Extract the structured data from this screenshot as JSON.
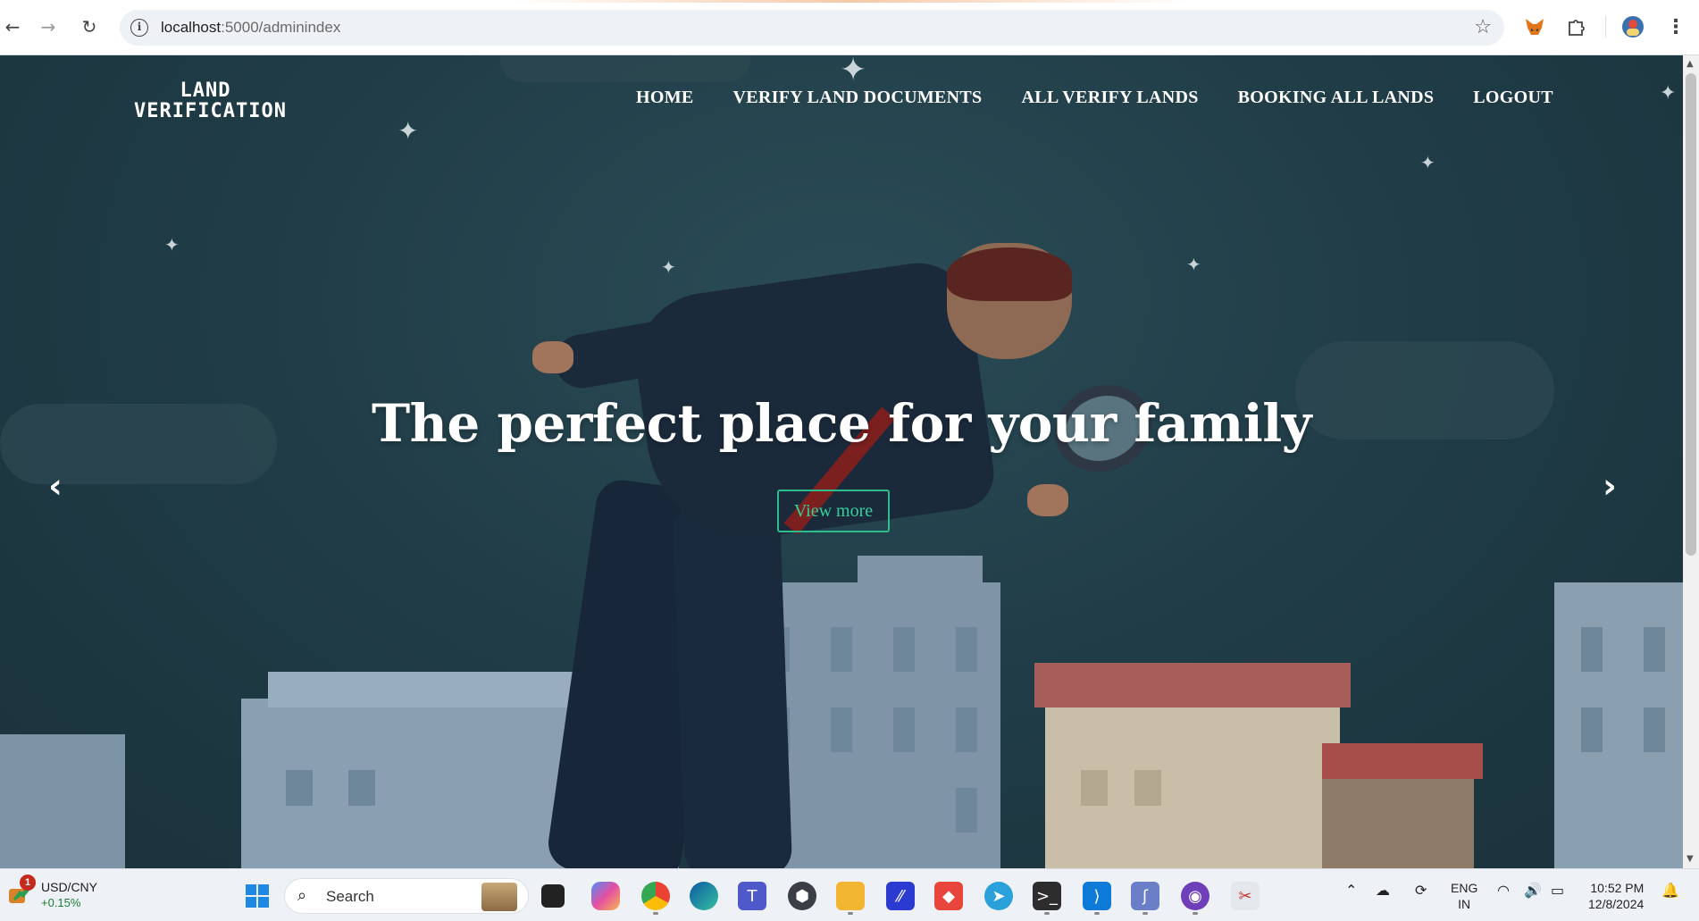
{
  "browser": {
    "url_host": "localhost",
    "url_path": ":5000/adminindex"
  },
  "site": {
    "logo_line1": "LAND",
    "logo_line2": "VERIFICATION",
    "nav": [
      {
        "label": "HOME"
      },
      {
        "label": "VERIFY LAND DOCUMENTS"
      },
      {
        "label": "ALL VERIFY LANDS"
      },
      {
        "label": "BOOKING ALL LANDS"
      },
      {
        "label": "LOGOUT"
      }
    ]
  },
  "hero": {
    "title": "The perfect place for your family",
    "button": "View more",
    "prev": "‹",
    "next": "›"
  },
  "taskbar": {
    "widget_label": "USD/CNY",
    "widget_delta": "+0.15%",
    "widget_badge": "1",
    "search_placeholder": "Search",
    "lang_line1": "ENG",
    "lang_line2": "IN",
    "time": "10:52 PM",
    "date": "12/8/2024"
  },
  "colors": {
    "accent_button": "#2dbd8a",
    "page_bg": "#1e3a44"
  }
}
